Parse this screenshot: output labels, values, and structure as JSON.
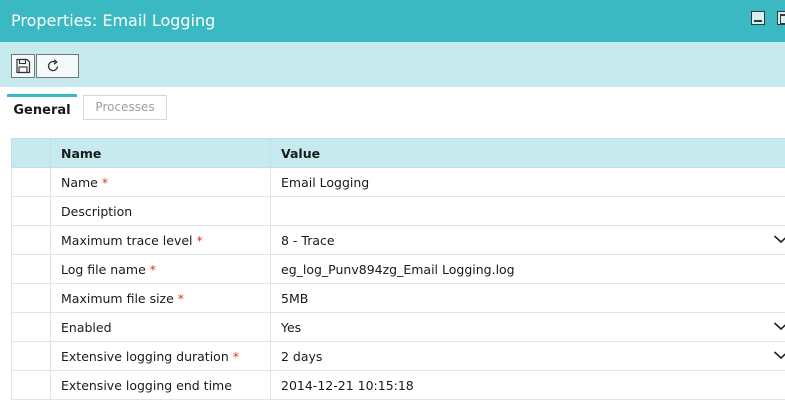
{
  "window": {
    "title": "Properties: Email Logging",
    "buttons": [
      "minimize-icon",
      "maximize-icon"
    ]
  },
  "toolbar": {
    "buttons": [
      "save-icon",
      "refresh-icon"
    ]
  },
  "tabs": [
    {
      "label": "General",
      "active": true
    },
    {
      "label": "Processes",
      "active": false
    }
  ],
  "grid": {
    "headers": {
      "name": "Name",
      "value": "Value"
    },
    "required_marker": "*",
    "rows": [
      {
        "name": "Name",
        "required": true,
        "value": "Email Logging",
        "dropdown": false
      },
      {
        "name": "Description",
        "required": false,
        "value": "",
        "dropdown": false
      },
      {
        "name": "Maximum trace level",
        "required": true,
        "value": "8 - Trace",
        "dropdown": true
      },
      {
        "name": "Log file name",
        "required": true,
        "value": "eg_log_Punv894zg_Email Logging.log",
        "dropdown": false
      },
      {
        "name": "Maximum file size",
        "required": true,
        "value": "5MB",
        "dropdown": false
      },
      {
        "name": "Enabled",
        "required": false,
        "value": "Yes",
        "dropdown": true
      },
      {
        "name": "Extensive logging duration",
        "required": true,
        "value": "2 days",
        "dropdown": true
      },
      {
        "name": "Extensive logging end time",
        "required": false,
        "value": "2014-12-21 10:15:18",
        "dropdown": false
      }
    ]
  },
  "colors": {
    "title_bar": "#3ab9c3",
    "toolbar": "#c6eaee",
    "header_row": "#c6eaee",
    "required": "#e0342a"
  }
}
